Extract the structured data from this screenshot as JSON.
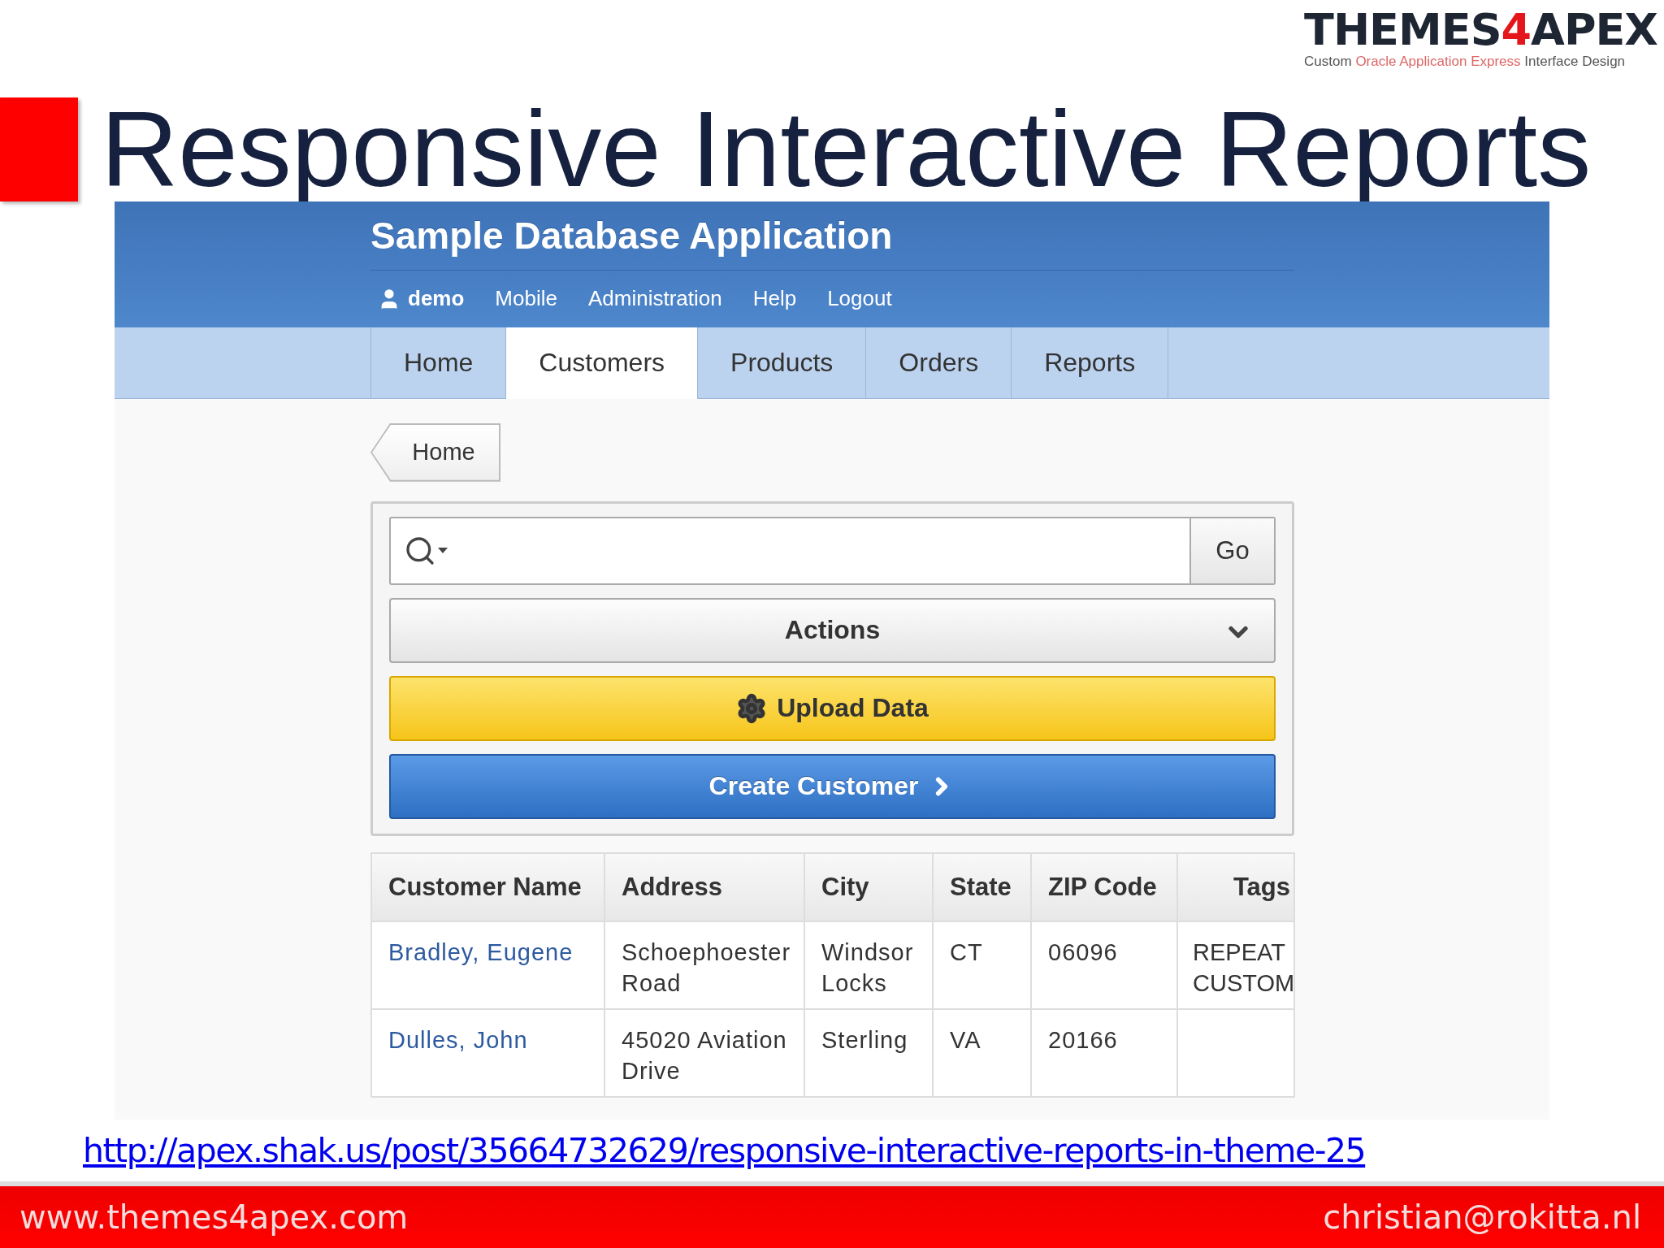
{
  "logo": {
    "wordmark": [
      "THEMES",
      "4",
      "APEX"
    ],
    "tagline": [
      "Custom ",
      "Oracle Application Express",
      " Interface Design"
    ]
  },
  "slide_title": "Responsive Interactive Reports",
  "app": {
    "title": "Sample Database Application",
    "user": "demo",
    "nav_links": [
      "Mobile",
      "Administration",
      "Help",
      "Logout"
    ],
    "tabs": [
      {
        "label": "Home",
        "selected": false
      },
      {
        "label": "Customers",
        "selected": true
      },
      {
        "label": "Products",
        "selected": false
      },
      {
        "label": "Orders",
        "selected": false
      },
      {
        "label": "Reports",
        "selected": false
      }
    ],
    "breadcrumb": "Home",
    "search": {
      "button": "Go"
    },
    "actions": "Actions",
    "upload_button": "Upload Data",
    "create_button": "Create Customer",
    "table": {
      "columns": [
        "Customer Name",
        "Address",
        "City",
        "State",
        "ZIP Code",
        "Tags"
      ],
      "rows": [
        [
          "Bradley, Eugene",
          "Schoephoester Road",
          "Windsor Locks",
          "CT",
          "06096",
          "REPEAT CUSTOM"
        ],
        [
          "Dulles, John",
          "45020 Aviation Drive",
          "Sterling",
          "VA",
          "20166",
          ""
        ]
      ]
    }
  },
  "link": "http://apex.shak.us/post/35664732629/responsive-interactive-reports-in-theme-25",
  "footer": {
    "left": "www.themes4apex.com",
    "right": "christian@rokitta.nl"
  }
}
